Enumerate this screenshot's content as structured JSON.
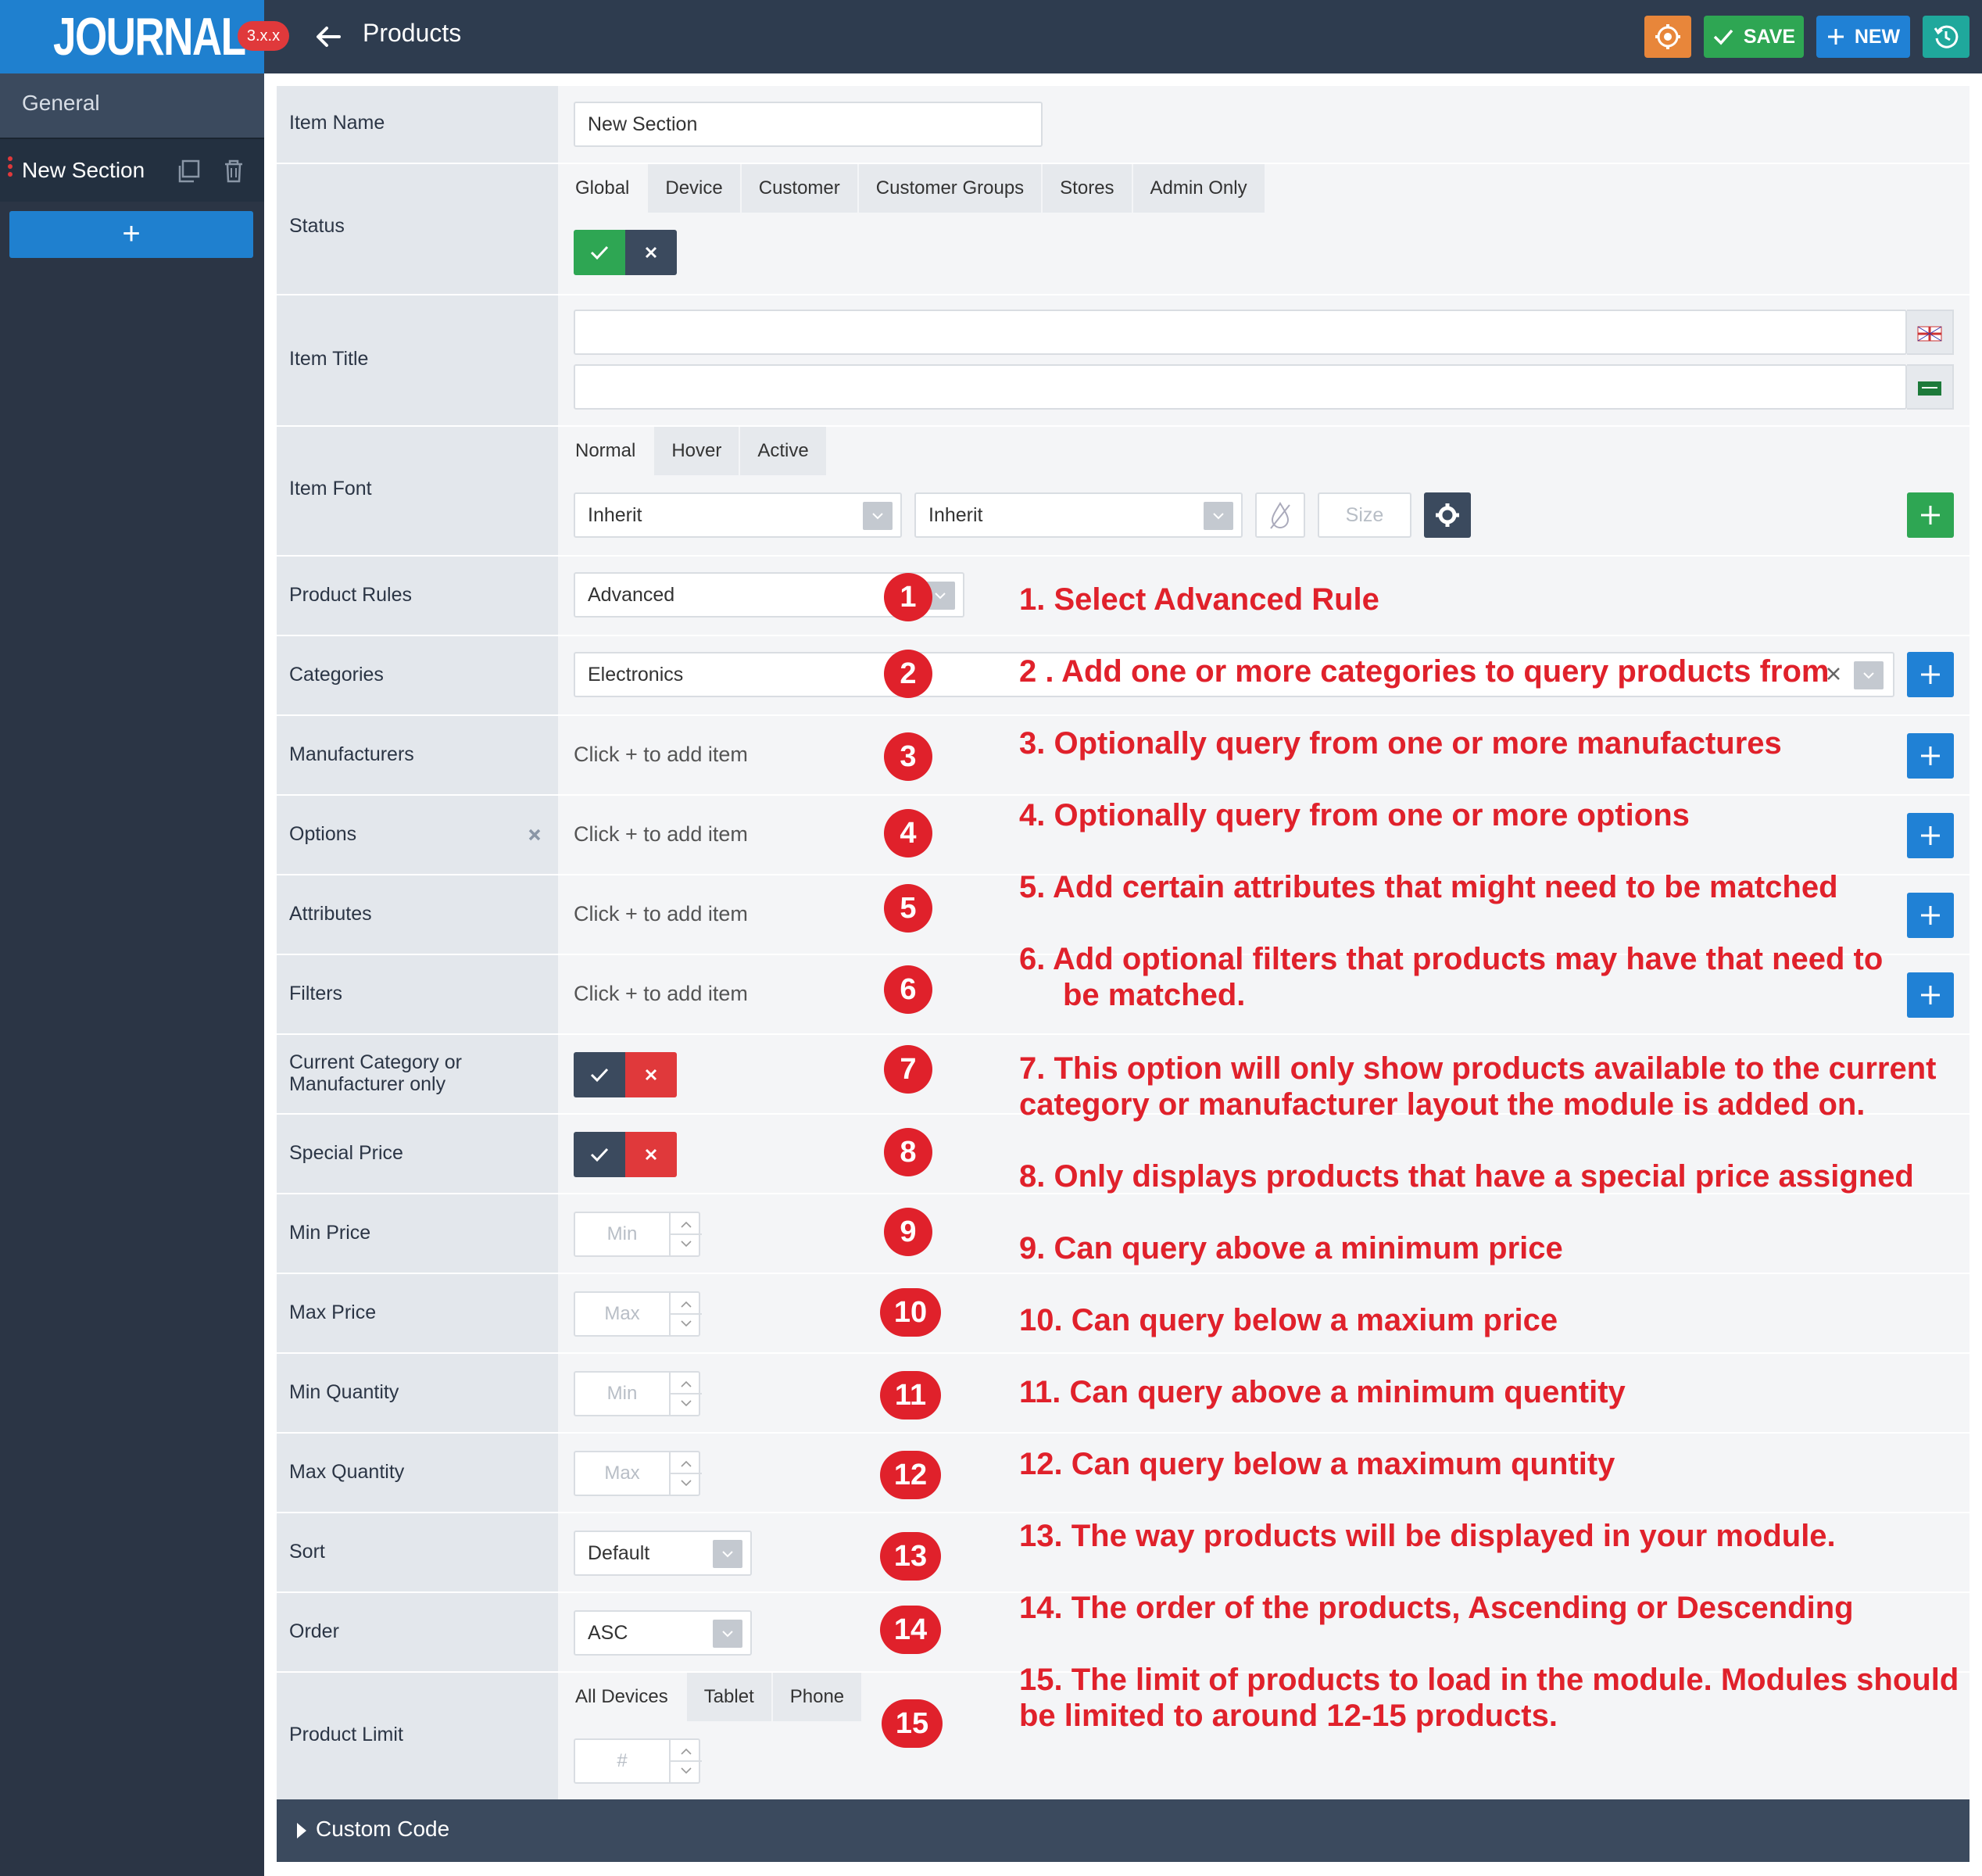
{
  "header": {
    "logo": "JOURNAL",
    "version": "3.x.x",
    "title": "Products",
    "save_label": "SAVE",
    "new_label": "NEW"
  },
  "sidebar": {
    "general": "General",
    "item": "New Section"
  },
  "form": {
    "item_name": {
      "label": "Item Name",
      "value": "New Section"
    },
    "status": {
      "label": "Status",
      "tabs": [
        "Global",
        "Device",
        "Customer",
        "Customer Groups",
        "Stores",
        "Admin Only"
      ]
    },
    "item_title": {
      "label": "Item Title"
    },
    "item_font": {
      "label": "Item Font",
      "tabs": [
        "Normal",
        "Hover",
        "Active"
      ],
      "family": "Inherit",
      "weight": "Inherit",
      "size_placeholder": "Size"
    },
    "product_rules": {
      "label": "Product Rules",
      "value": "Advanced"
    },
    "categories": {
      "label": "Categories",
      "value": "Electronics"
    },
    "manufacturers": {
      "label": "Manufacturers",
      "placeholder": "Click + to add item"
    },
    "options": {
      "label": "Options",
      "placeholder": "Click + to add item"
    },
    "attributes": {
      "label": "Attributes",
      "placeholder": "Click + to add item"
    },
    "filters": {
      "label": "Filters",
      "placeholder": "Click + to add item"
    },
    "current_category": {
      "label_line1": "Current Category or",
      "label_line2": "Manufacturer only"
    },
    "special_price": {
      "label": "Special Price"
    },
    "min_price": {
      "label": "Min Price",
      "placeholder": "Min"
    },
    "max_price": {
      "label": "Max Price",
      "placeholder": "Max"
    },
    "min_quantity": {
      "label": "Min Quantity",
      "placeholder": "Min"
    },
    "max_quantity": {
      "label": "Max Quantity",
      "placeholder": "Max"
    },
    "sort": {
      "label": "Sort",
      "value": "Default"
    },
    "order": {
      "label": "Order",
      "value": "ASC"
    },
    "product_limit": {
      "label": "Product Limit",
      "tabs": [
        "All Devices",
        "Tablet",
        "Phone"
      ],
      "placeholder": "#"
    }
  },
  "custom_code": "Custom Code",
  "annotations": [
    {
      "n": "1",
      "text": "1. Select Advanced Rule"
    },
    {
      "n": "2",
      "text": "2 . Add one or more categories to query products from"
    },
    {
      "n": "3",
      "text": "3. Optionally query from one or more manufactures"
    },
    {
      "n": "4",
      "text": "4. Optionally query from one or more options"
    },
    {
      "n": "5",
      "text": "5. Add certain attributes that might need to be matched"
    },
    {
      "n": "6",
      "text": "6. Add optional filters that products may have that need to",
      "text2": "be matched."
    },
    {
      "n": "7",
      "text": "7. This option will only show products available to the current",
      "text2": "category or manufacturer layout the module is added on."
    },
    {
      "n": "8",
      "text": "8.  Only displays products that have a special price assigned"
    },
    {
      "n": "9",
      "text": "9.  Can query above a minimum price"
    },
    {
      "n": "10",
      "text": "10. Can query below a maxium price"
    },
    {
      "n": "11",
      "text": "11. Can query above a minimum quentity"
    },
    {
      "n": "12",
      "text": "12. Can query below a maximum quntity"
    },
    {
      "n": "13",
      "text": "13. The way products will be displayed in your module."
    },
    {
      "n": "14",
      "text": "14. The order of the products, Ascending or Descending"
    },
    {
      "n": "15",
      "text": "15. The limit of products to load in the module. Modules should",
      "text2": "be limited to around 12-15 products."
    }
  ],
  "colors": {
    "accent_blue": "#2081d5",
    "save_green": "#2ea653",
    "annotation_red": "#e0212b",
    "topbar": "#2e3c4f"
  }
}
